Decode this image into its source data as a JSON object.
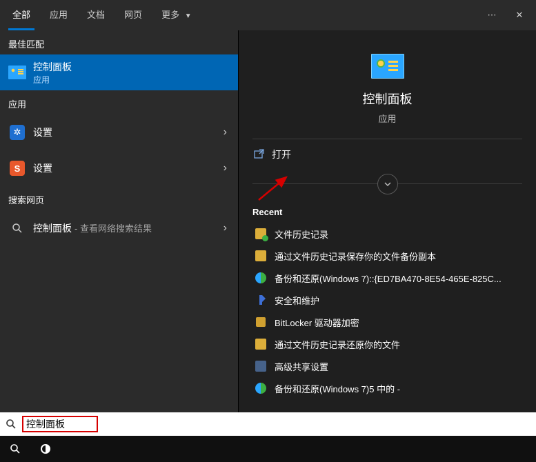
{
  "topTabs": {
    "all": "全部",
    "apps": "应用",
    "docs": "文档",
    "web": "网页",
    "more": "更多"
  },
  "sections": {
    "bestMatch": "最佳匹配",
    "apps": "应用",
    "searchWeb": "搜索网页"
  },
  "bestResult": {
    "title": "控制面板",
    "subtitle": "应用"
  },
  "appResults": {
    "settings1": "设置",
    "settings2": "设置"
  },
  "webResult": {
    "title": "控制面板",
    "suffix": "- 查看网络搜索结果"
  },
  "details": {
    "title": "控制面板",
    "subtitle": "应用",
    "openAction": "打开",
    "recentHeader": "Recent",
    "recent": {
      "r1": "文件历史记录",
      "r2": "通过文件历史记录保存你的文件备份副本",
      "r3": "备份和还原(Windows 7)::{ED7BA470-8E54-465E-825C...",
      "r4": "安全和维护",
      "r5": "BitLocker 驱动器加密",
      "r6": "通过文件历史记录还原你的文件",
      "r7": "高级共享设置",
      "r8": "备份和还原(Windows 7)5 中的 -"
    }
  },
  "search": {
    "value": "控制面板"
  }
}
